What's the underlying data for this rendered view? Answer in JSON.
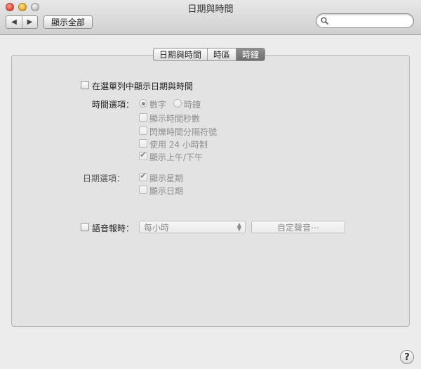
{
  "window": {
    "title": "日期與時間"
  },
  "toolbar": {
    "back_icon": "◀",
    "forward_icon": "▶",
    "show_all_label": "顯示全部",
    "search_placeholder": ""
  },
  "tabs": [
    {
      "label": "日期與時間",
      "selected": false
    },
    {
      "label": "時區",
      "selected": false
    },
    {
      "label": "時鐘",
      "selected": true
    }
  ],
  "clock": {
    "show_in_menubar": {
      "label": "在選單列中顯示日期與時間",
      "checked": false
    },
    "time_options_label": "時間選項：",
    "radio_digital": {
      "label": "數字",
      "selected": true
    },
    "radio_analog": {
      "label": "時鐘",
      "selected": false
    },
    "time_checkboxes": [
      {
        "label": "顯示時間秒數",
        "checked": false
      },
      {
        "label": "閃爍時間分隔符號",
        "checked": false
      },
      {
        "label": "使用 24 小時制",
        "checked": false
      },
      {
        "label": "顯示上午/下午",
        "checked": true
      }
    ],
    "date_options_label": "日期選項：",
    "date_checkboxes": [
      {
        "label": "顯示星期",
        "checked": true
      },
      {
        "label": "顯示日期",
        "checked": false
      }
    ],
    "announce": {
      "label": "語音報時：",
      "checked": false
    },
    "interval_value": "每小時",
    "custom_voice_label": "自定聲音⋯"
  },
  "help_label": "?"
}
